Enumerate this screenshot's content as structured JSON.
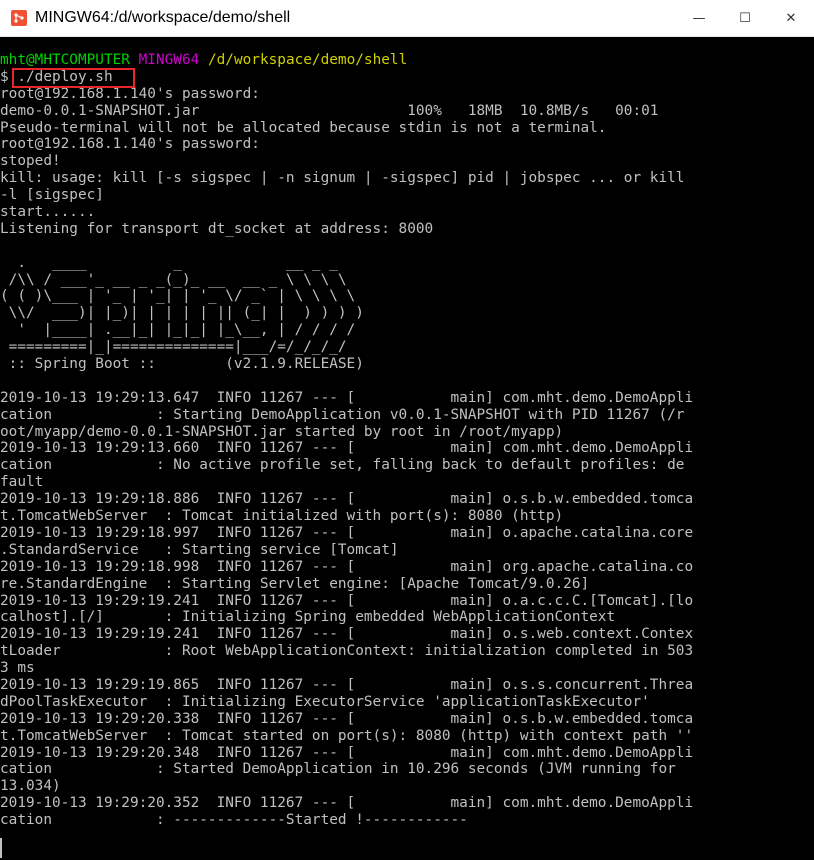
{
  "window": {
    "title": "MINGW64:/d/workspace/demo/shell",
    "controls": {
      "minimize": "—",
      "maximize": "☐",
      "close": "✕"
    },
    "icon": "git-bash-icon"
  },
  "terminal": {
    "prompt": {
      "user_host": "mht@MHTCOMPUTER",
      "shell": "MINGW64",
      "path": "/d/workspace/demo/shell"
    },
    "lines": [
      "$ ./deploy.sh",
      "root@192.168.1.140's password:",
      "demo-0.0.1-SNAPSHOT.jar                        100%   18MB  10.8MB/s   00:01",
      "Pseudo-terminal will not be allocated because stdin is not a terminal.",
      "root@192.168.1.140's password:",
      "stoped!",
      "kill: usage: kill [-s sigspec | -n signum | -sigspec] pid | jobspec ... or kill",
      "-l [sigspec]",
      "start......",
      "Listening for transport dt_socket at address: 8000",
      "",
      "  .   ____          _            __ _ _",
      " /\\\\ / ___'_ __ _ _(_)_ __  __ _ \\ \\ \\ \\",
      "( ( )\\___ | '_ | '_| | '_ \\/ _` | \\ \\ \\ \\",
      " \\\\/  ___)| |_)| | | | | || (_| |  ) ) ) )",
      "  '  |____| .__|_| |_|_| |_\\__, | / / / /",
      " =========|_|==============|___/=/_/_/_/",
      " :: Spring Boot ::        (v2.1.9.RELEASE)",
      "",
      "2019-10-13 19:29:13.647  INFO 11267 --- [           main] com.mht.demo.DemoAppli",
      "cation            : Starting DemoApplication v0.0.1-SNAPSHOT with PID 11267 (/r",
      "oot/myapp/demo-0.0.1-SNAPSHOT.jar started by root in /root/myapp)",
      "2019-10-13 19:29:13.660  INFO 11267 --- [           main] com.mht.demo.DemoAppli",
      "cation            : No active profile set, falling back to default profiles: de",
      "fault",
      "2019-10-13 19:29:18.886  INFO 11267 --- [           main] o.s.b.w.embedded.tomca",
      "t.TomcatWebServer  : Tomcat initialized with port(s): 8080 (http)",
      "2019-10-13 19:29:18.997  INFO 11267 --- [           main] o.apache.catalina.core",
      ".StandardService   : Starting service [Tomcat]",
      "2019-10-13 19:29:18.998  INFO 11267 --- [           main] org.apache.catalina.co",
      "re.StandardEngine  : Starting Servlet engine: [Apache Tomcat/9.0.26]",
      "2019-10-13 19:29:19.241  INFO 11267 --- [           main] o.a.c.c.C.[Tomcat].[lo",
      "calhost].[/]       : Initializing Spring embedded WebApplicationContext",
      "2019-10-13 19:29:19.241  INFO 11267 --- [           main] o.s.web.context.Contex",
      "tLoader            : Root WebApplicationContext: initialization completed in 503",
      "3 ms",
      "2019-10-13 19:29:19.865  INFO 11267 --- [           main] o.s.s.concurrent.Threa",
      "dPoolTaskExecutor  : Initializing ExecutorService 'applicationTaskExecutor'",
      "2019-10-13 19:29:20.338  INFO 11267 --- [           main] o.s.b.w.embedded.tomca",
      "t.TomcatWebServer  : Tomcat started on port(s): 8080 (http) with context path ''",
      "2019-10-13 19:29:20.348  INFO 11267 --- [           main] com.mht.demo.DemoAppli",
      "cation            : Started DemoApplication in 10.296 seconds (JVM running for",
      "13.034)",
      "2019-10-13 19:29:20.352  INFO 11267 --- [           main] com.mht.demo.DemoAppli",
      "cation            : -------------Started !------------"
    ]
  },
  "colors": {
    "background": "#000000",
    "text": "#c0c0c0",
    "user_host": "#00d000",
    "shell": "#d000d0",
    "path": "#d0d000",
    "highlight_box": "#e8252a"
  }
}
